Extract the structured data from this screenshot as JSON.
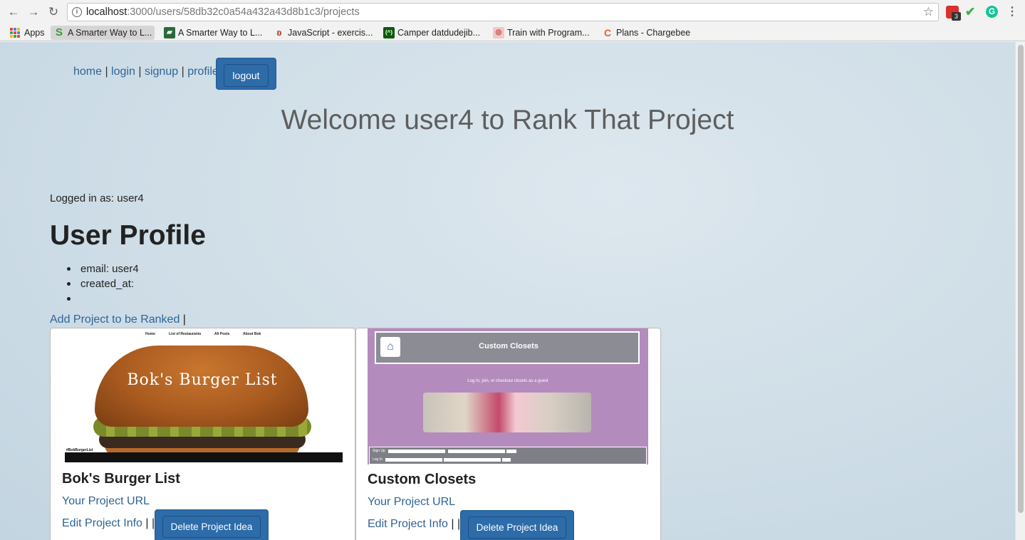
{
  "browser": {
    "url_host": "localhost",
    "url_path": ":3000/users/58db32c0a54a432a43d8b1c3/projects",
    "extension_badge": "3",
    "bookmarks": [
      {
        "label": "Apps"
      },
      {
        "label": "A Smarter Way to L..."
      },
      {
        "label": "A Smarter Way to L..."
      },
      {
        "label": "JavaScript - exercis..."
      },
      {
        "label": "Camper datdudejib..."
      },
      {
        "label": "Train with Program..."
      },
      {
        "label": "Plans - Chargebee"
      }
    ]
  },
  "nav": {
    "home": "home",
    "login": "login",
    "signup": "signup",
    "profile": "profile",
    "separator": "|",
    "logout": "logout"
  },
  "welcome": "Welcome user4 to Rank That Project",
  "logged_in": "Logged in as: user4",
  "profile": {
    "title": "User Profile",
    "items": [
      "email: user4",
      "created_at:",
      ""
    ]
  },
  "add_project": "Add Project to be Ranked",
  "add_project_sep": "|",
  "projects": [
    {
      "title": "Bok's Burger List",
      "url_label": "Your Project URL",
      "edit_label": "Edit Project Info",
      "separators": "| |",
      "delete_label": "Delete Project Idea",
      "thumb": {
        "nav": [
          "Home",
          "List of Restaurants",
          "All Posts",
          "About Bok"
        ],
        "banner": "Bok's Burger List",
        "hashtag": "#BokBurgerList"
      }
    },
    {
      "title": "Custom Closets",
      "url_label": "Your Project URL",
      "edit_label": "Edit Project Info",
      "separators": "| |",
      "delete_label": "Delete Project Idea",
      "thumb": {
        "header": "Custom Closets",
        "tagline": "Log In, join, or checkout closets as a guest",
        "signup": "Sign Up",
        "login": "Log In"
      }
    }
  ],
  "colors": {
    "link": "#2f6496",
    "button": "#2d6ba9",
    "heading": "#5e5e5e"
  }
}
